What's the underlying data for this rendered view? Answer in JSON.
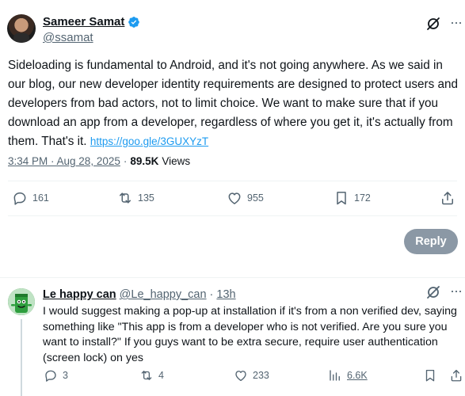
{
  "post": {
    "display_name": "Sameer Samat",
    "handle": "@ssamat",
    "more_label": "···",
    "body": "Sideloading is fundamental to Android, and it's not going anywhere. As we said in our blog, our new developer identity requirements are designed to protect users and developers from bad actors, not to limit choice. We want to make sure that if you download an app from a developer, regardless of where you get it, it's actually from them. That's it.",
    "link": "https://goo.gle/3GUXYzT",
    "time": "3:34 PM · Aug 28, 2025",
    "separator": "·",
    "views_count": "89.5K",
    "views_label": "Views",
    "stats": {
      "replies": "161",
      "reposts": "135",
      "likes": "955",
      "bookmarks": "172"
    },
    "reply_button_label": "Reply"
  },
  "reply": {
    "display_name": "Le happy can",
    "handle": "@Le_happy_can",
    "dot": "·",
    "time": "13h",
    "more_label": "···",
    "body": "I would suggest making a pop-up at installation if it's from a non verified dev, saying something like \"This app is from a developer who is not verified. Are you sure you want to install?\" If you guys want to be extra secure, require user authentication (screen lock) on yes",
    "stats": {
      "replies": "3",
      "reposts": "4",
      "likes": "233",
      "views": "6.6K"
    }
  },
  "colors": {
    "accent": "#1d9bf0",
    "muted": "#536471",
    "reply_button": "#8b98a5",
    "divider": "#eff3f4"
  },
  "icons": [
    "verified-badge-icon",
    "grok-icon",
    "more-icon",
    "reply-icon",
    "repost-icon",
    "like-icon",
    "bookmark-icon",
    "share-icon",
    "views-icon"
  ]
}
